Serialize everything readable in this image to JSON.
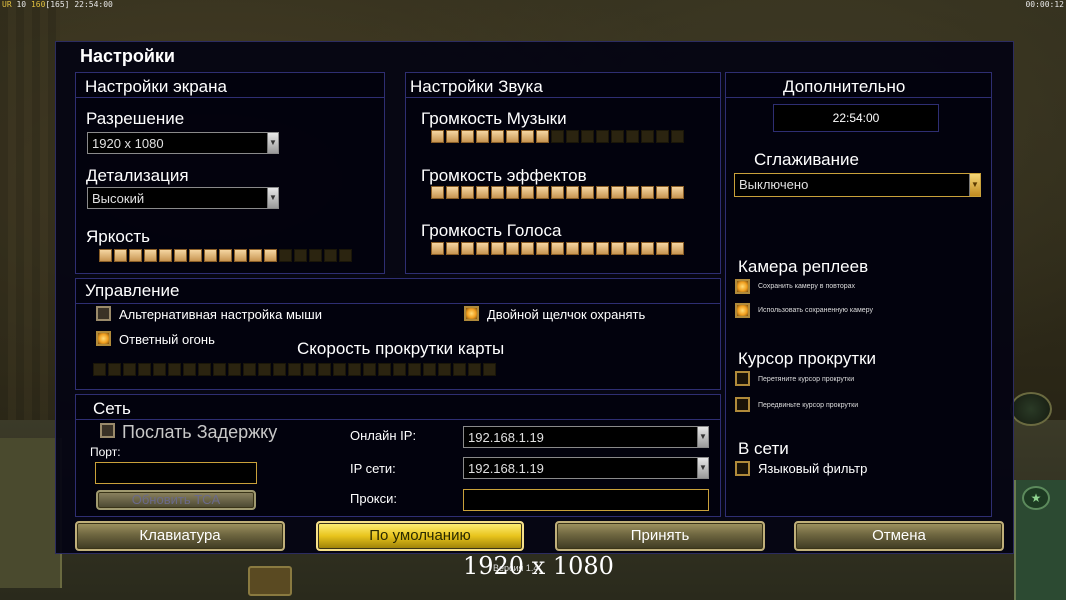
{
  "topbar": {
    "left_a": "UR",
    "left_b": "10",
    "left_c": "160",
    "left_d": "[165]",
    "left_time": "22:54:00",
    "right_time": "00:00:12"
  },
  "dialog": {
    "title": "Настройки"
  },
  "screen": {
    "title": "Настройки экрана",
    "resolution_label": "Разрешение",
    "resolution_value": "1920 x 1080",
    "detail_label": "Детализация",
    "detail_value": "Высокий",
    "brightness_label": "Яркость",
    "brightness_level": 12,
    "brightness_max": 17
  },
  "sound": {
    "title": "Настройки Звука",
    "music_label": "Громкость Музыки",
    "music_level": 8,
    "effects_label": "Громкость эффектов",
    "effects_level": 17,
    "voice_label": "Громкость Голоса",
    "voice_level": 17,
    "max": 17
  },
  "extra": {
    "title": "Дополнительно",
    "clock": "22:54:00",
    "aa_label": "Сглаживание",
    "aa_value": "Выключено",
    "replay_title": "Камера реплеев",
    "replay_opt1": "Сохранить камеру в повторах",
    "replay_opt2": "Использовать сохраненную камеру",
    "cursor_title": "Курсор прокрутки",
    "cursor_opt1": "Перетяните курсор прокрутки",
    "cursor_opt2": "Передвиньте курсор прокрутки",
    "online_title": "В сети",
    "lang_filter": "Языковый фильтр"
  },
  "control": {
    "title": "Управление",
    "alt_mouse": "Альтернативная настройка мыши",
    "double_click": "Двойной щелчок охранять",
    "return_fire": "Ответный огонь",
    "scroll_label": "Скорость прокрутки карты",
    "scroll_level": 0,
    "scroll_max": 27
  },
  "network": {
    "title": "Сеть",
    "send_delay": "Послать Задержку",
    "port_label": "Порт:",
    "port_value": "",
    "update_tca": "Обновить TCA",
    "online_ip_label": "Онлайн IP:",
    "online_ip_value": "192.168.1.19",
    "lan_ip_label": "IP сети:",
    "lan_ip_value": "192.168.1.19",
    "proxy_label": "Прокси:",
    "proxy_value": ""
  },
  "buttons": {
    "keyboard": "Клавиатура",
    "defaults": "По умолчанию",
    "accept": "Принять",
    "cancel": "Отмена"
  },
  "footer": {
    "resolution": "1920 x 1080",
    "version": "Версия 1.4"
  },
  "colors": {
    "accent": "#c9a13a",
    "panel_border": "#2e2e72",
    "slider_on": "#e9be80",
    "dialog_bg": "#03030f"
  }
}
